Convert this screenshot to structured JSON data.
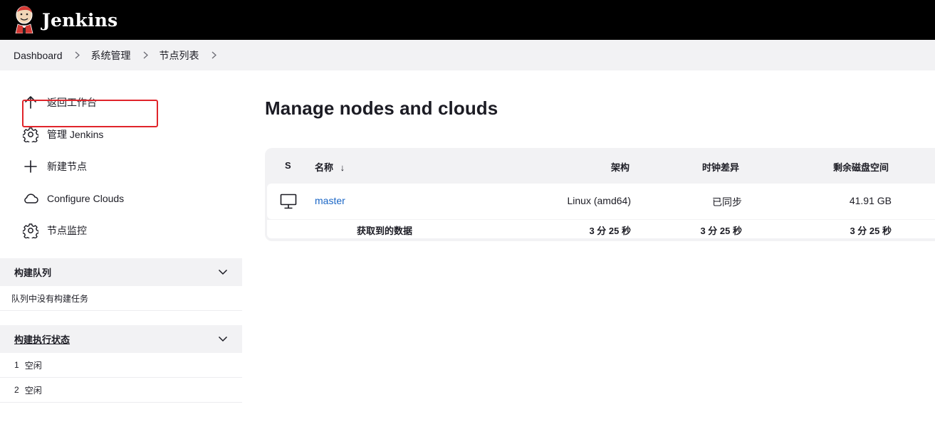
{
  "header": {
    "app_name": "Jenkins",
    "logo_icon": "jenkins-butler-icon"
  },
  "breadcrumb": {
    "items": [
      "Dashboard",
      "系统管理",
      "节点列表"
    ]
  },
  "tasks": [
    {
      "label": "返回工作台",
      "icon": "arrow-up-icon"
    },
    {
      "label": "管理 Jenkins",
      "icon": "gear-icon"
    },
    {
      "label": "新建节点",
      "icon": "plus-icon"
    },
    {
      "label": "Configure Clouds",
      "icon": "cloud-icon",
      "highlighted": true
    },
    {
      "label": "节点监控",
      "icon": "gear-icon"
    }
  ],
  "build_queue": {
    "title": "构建队列",
    "empty_text": "队列中没有构建任务"
  },
  "executors": {
    "title": "构建执行状态",
    "rows": [
      {
        "num": "1",
        "status": "空闲"
      },
      {
        "num": "2",
        "status": "空闲"
      }
    ]
  },
  "main": {
    "title": "Manage nodes and clouds",
    "table": {
      "headers": {
        "s": "S",
        "name": "名称",
        "sort_arrow": "↓",
        "arch": "架构",
        "clock": "时钟差异",
        "disk": "剩余磁盘空间"
      },
      "rows": [
        {
          "name": "master",
          "arch": "Linux (amd64)",
          "clock": "已同步",
          "disk": "41.91 GB"
        }
      ],
      "footer": {
        "label": "获取到的数据",
        "arch": "3 分 25 秒",
        "clock": "3 分 25 秒",
        "disk": "3 分 25 秒"
      }
    }
  },
  "colors": {
    "header_bg": "#000000",
    "link": "#1a66c6",
    "highlight": "#e0242a",
    "panel_bg": "#f2f2f4"
  }
}
